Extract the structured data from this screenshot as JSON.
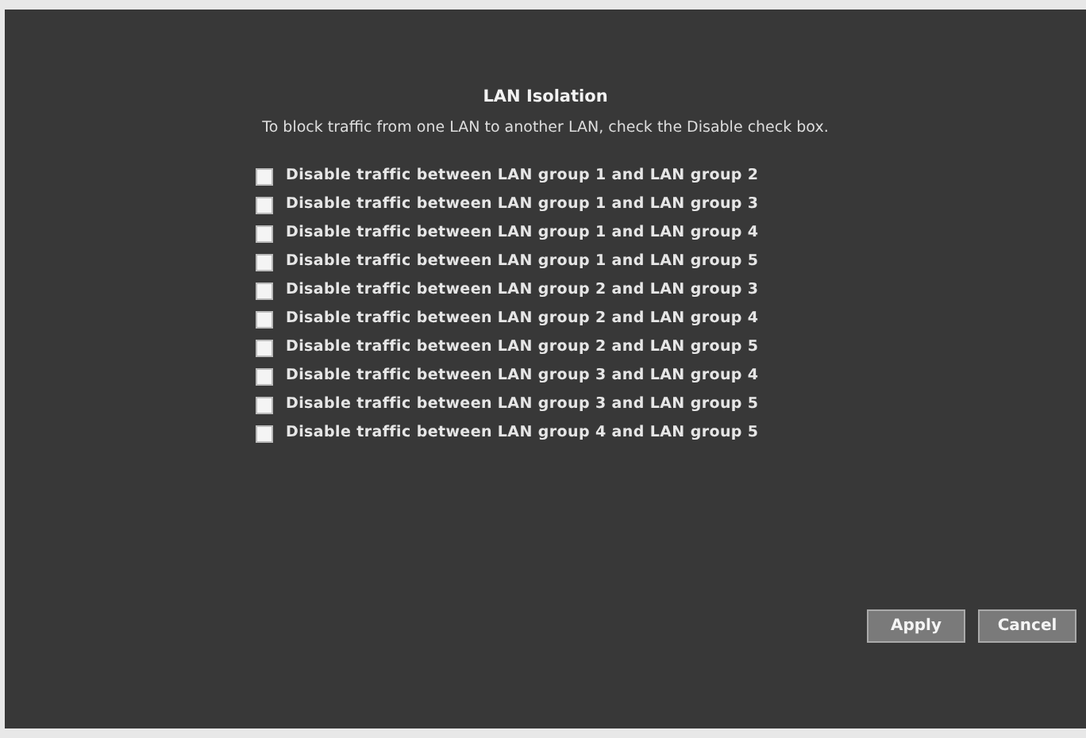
{
  "title": "LAN Isolation",
  "description": "To block traffic from one LAN to another LAN, check the Disable check box.",
  "options": [
    {
      "label": "Disable traffic between LAN group 1 and LAN group 2",
      "checked": false
    },
    {
      "label": "Disable traffic between LAN group 1 and LAN group 3",
      "checked": false
    },
    {
      "label": "Disable traffic between LAN group 1 and LAN group 4",
      "checked": false
    },
    {
      "label": "Disable traffic between LAN group 1 and LAN group 5",
      "checked": false
    },
    {
      "label": "Disable traffic between LAN group 2 and LAN group 3",
      "checked": false
    },
    {
      "label": "Disable traffic between LAN group 2 and LAN group 4",
      "checked": false
    },
    {
      "label": "Disable traffic between LAN group 2 and LAN group 5",
      "checked": false
    },
    {
      "label": "Disable traffic between LAN group 3 and LAN group 4",
      "checked": false
    },
    {
      "label": "Disable traffic between LAN group 3 and LAN group 5",
      "checked": false
    },
    {
      "label": "Disable traffic between LAN group 4 and LAN group 5",
      "checked": false
    }
  ],
  "buttons": [
    "Apply",
    "Cancel"
  ]
}
